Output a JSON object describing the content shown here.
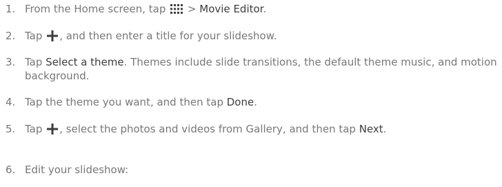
{
  "steps": [
    {
      "number": "1.",
      "parts": [
        "From the Home screen, tap",
        "> ",
        "Movie Editor",
        "."
      ]
    },
    {
      "number": "2.",
      "parts": [
        "Tap",
        ", and then enter a title for your slideshow."
      ]
    },
    {
      "number": "3.",
      "parts": [
        "Tap ",
        "Select a theme",
        ". Themes include slide transitions, the default theme music, and motion background."
      ]
    },
    {
      "number": "4.",
      "parts": [
        "Tap the theme you want, and then tap ",
        "Done",
        "."
      ]
    },
    {
      "number": "5.",
      "parts": [
        "Tap",
        ", select the photos and videos from Gallery, and then tap ",
        "Next",
        "."
      ]
    },
    {
      "number": "6.",
      "parts": [
        "Edit your slideshow:"
      ]
    }
  ],
  "icons": {
    "apps": "all-apps-grid-icon",
    "add": "plus-icon"
  },
  "colors": {
    "body_text": "#777777",
    "emphasis_text": "#3d3d3d"
  }
}
